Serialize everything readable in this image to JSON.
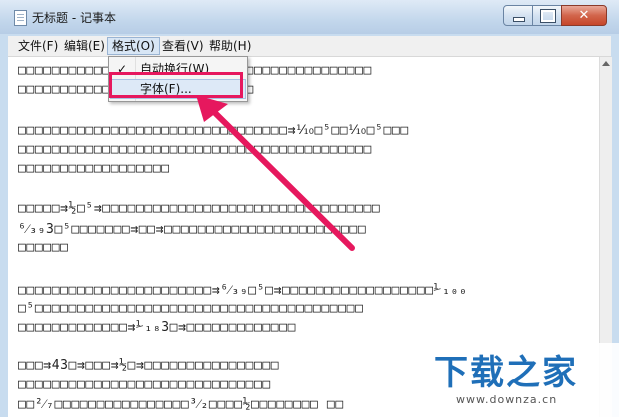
{
  "window": {
    "title": "无标题 - 记事本",
    "close_glyph": "✕"
  },
  "menubar": {
    "items": [
      {
        "label": "文件(F)"
      },
      {
        "label": "编辑(E)"
      },
      {
        "label": "格式(O)",
        "active": true
      },
      {
        "label": "查看(V)"
      },
      {
        "label": "帮助(H)"
      }
    ]
  },
  "format_menu": {
    "items": [
      {
        "check": "✓",
        "label": "自动换行(W)"
      },
      {
        "check": "",
        "label": "字体(F)..."
      }
    ]
  },
  "editor": {
    "lines": [
      "□□□□□□□□□□□□□□□□□□□□□□□□□□□□□□□□□□□□□□□□□□",
      "□□□□□□□□□□□□□□□□□□□□□□□□□□□□",
      "",
      "□□□□□□□□□□□□□□□□□□□□□□□□□□□□□□□□⇉⅒□⁵□□⅒□⁵□□□",
      "□□□□□□□□□□□□□□□□□□□□□□□□□□□□□□□□□□□□□□□□□□",
      "□□□□□□□□□□□□□□□□□□",
      "",
      "□□□□□⇉½□⁵⇉□□□□□□□□□□□□□□□□□□□□□□□□□□□□□□□□□",
      "⁶⁄₃₉3□⁵□□□□□□□⇉□□⇉□□□□□□□□□□□□□□□□□□□□□□□□",
      "□□□□□□",
      "",
      "□□□□□□□□□□□□□□□□□□□□□□□⇉⁶⁄₃₉□⁵□⇉□□□□□□□□□□□□□□□□□□⅟₁₀₀",
      "□⁵□□□□□□□□□□□□□□□□□□□□□□□□□□□□□□□□□□□□□□□",
      "□□□□□□□□□□□□□⇉⅟₁₈3□⇉□□□□□□□□□□□□□",
      "",
      "□□□⇉43□⇉□□□⇉½□⇉□□□□□□□□□□□□□□□□",
      "□□□□□□□□□□□□□□□□□□□□□□□□□□□□□□",
      "□□²⁄₇□□□□□□□□□□□□□□□□³⁄₂□□□□½□□□□□□□□ □□"
    ]
  },
  "watermark": {
    "logo": "下载之家",
    "url": "www.downza.cn"
  },
  "colors": {
    "highlight": "#e6185e",
    "arrow": "#e6185e",
    "watermark_blue": "#1f6fb8"
  }
}
